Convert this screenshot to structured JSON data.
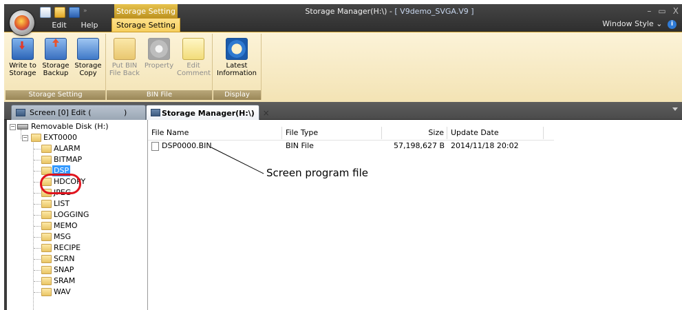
{
  "window": {
    "title_app": "Storage Manager(H:\\) - ",
    "title_file": "[ V9demo_SVGA.V9 ]",
    "context_tab_title": "Storage Setting",
    "controls": [
      "–",
      "▭",
      "X"
    ]
  },
  "quick_access": {
    "icons": [
      "new-file-icon",
      "open-folder-icon",
      "save-icon"
    ],
    "more": "»"
  },
  "ribbon_tabs": [
    "Edit",
    "Help",
    "Storage Setting"
  ],
  "window_style": {
    "label": "Window Style",
    "chevron": "⌄",
    "help": "i"
  },
  "ribbon": {
    "groups": [
      {
        "label": "Storage Setting",
        "buttons": [
          {
            "line1": "Write to",
            "line2": "Storage",
            "icon": "write-to-storage-icon"
          },
          {
            "line1": "Storage",
            "line2": "Backup",
            "icon": "storage-backup-icon"
          },
          {
            "line1": "Storage",
            "line2": "Copy",
            "icon": "storage-copy-icon"
          }
        ]
      },
      {
        "label": "BIN File",
        "buttons": [
          {
            "line1": "Put BIN",
            "line2": "File Back",
            "icon": "folder-icon"
          },
          {
            "line1": "Property",
            "line2": "",
            "icon": "gear-icon"
          },
          {
            "line1": "Edit",
            "line2": "Comment",
            "icon": "comment-icon"
          }
        ]
      },
      {
        "label": "Display",
        "buttons": [
          {
            "line1": "Latest",
            "line2": "Information",
            "icon": "refresh-icon"
          }
        ]
      }
    ]
  },
  "doc_tabs": {
    "inactive": "Screen [0] Edit (",
    "inactive_paren": ")",
    "active": "Storage Manager(H:\\)",
    "close": "×"
  },
  "tree": {
    "root": "Removable Disk (H:)",
    "folder": "EXT0000",
    "children": [
      "ALARM",
      "BITMAP",
      "DSP",
      "HDCOPY",
      "JPEG",
      "LIST",
      "LOGGING",
      "MEMO",
      "MSG",
      "RECIPE",
      "SCRN",
      "SNAP",
      "SRAM",
      "WAV"
    ],
    "selected": "DSP"
  },
  "list": {
    "columns": [
      "File Name",
      "File Type",
      "Size",
      "Update Date"
    ],
    "rows": [
      {
        "name": "DSP0000.BIN",
        "type": "BIN File",
        "size": "57,198,627 B",
        "date": "2014/11/18 20:02"
      }
    ]
  },
  "annotation": {
    "callout": "Screen program file",
    "highlight_color": "#e0141e"
  },
  "colors": {
    "titlebar": "#3b3b3b",
    "ribbon_tab_active": "#f6cf5e",
    "ribbon_body": "#fcf3d8",
    "selection": "#3399ff"
  }
}
